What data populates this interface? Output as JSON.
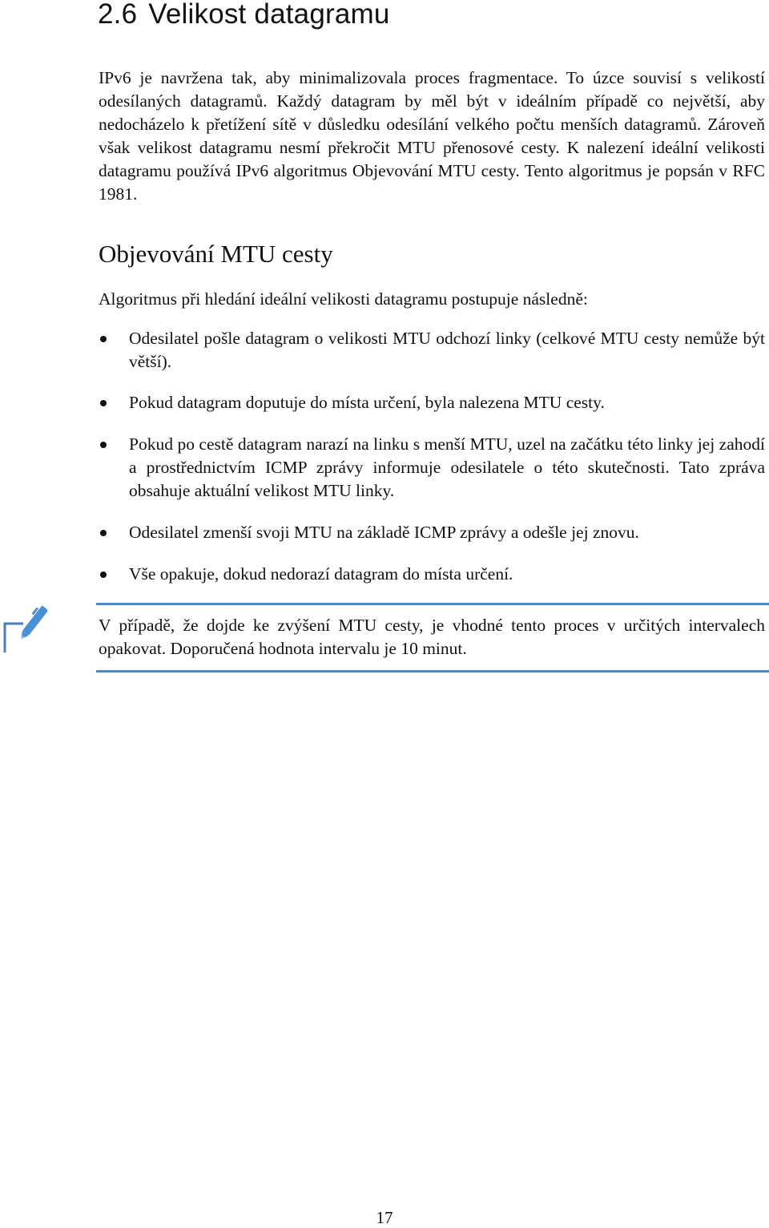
{
  "section": {
    "number": "2.6",
    "title": "Velikost datagramu"
  },
  "intro_paragraph": "IPv6 je navržena tak, aby minimalizovala proces fragmentace. To úzce souvisí s velikostí odesílaných datagramů. Každý datagram by měl být v ideálním případě co největší, aby nedocházelo k přetížení sítě v důsledku odesílání velkého počtu menších datagramů. Zároveň však velikost datagramu nesmí překročit MTU přenosové cesty. K nalezení ideální velikosti datagramu používá IPv6 algoritmus Objevování MTU cesty. Tento algoritmus je popsán v RFC 1981.",
  "subsection": {
    "title": "Objevování MTU cesty",
    "lead": "Algoritmus při hledání ideální velikosti datagramu postupuje následně:",
    "steps": [
      "Odesilatel pošle datagram o velikosti MTU odchozí linky (celkové MTU cesty nemůže být větší).",
      "Pokud datagram doputuje do místa určení, byla nalezena MTU cesty.",
      "Pokud po cestě datagram narazí na linku s menší MTU, uzel na začátku této linky jej zahodí a prostřednictvím ICMP zprávy informuje odesilatele o této skutečnosti. Tato zpráva obsahuje aktuální velikost MTU linky.",
      "Odesilatel zmenší svoji MTU na základě ICMP zprávy a odešle jej znovu.",
      "Vše opakuje, dokud nedorazí datagram do místa určení."
    ]
  },
  "note": {
    "icon": "pen-note-icon",
    "text": "V případě, že dojde ke zvýšení MTU cesty, je vhodné tento proces v určitých intervalech opakovat. Doporučená hodnota intervalu je 10 minut.",
    "accent_color": "#4a8bc8"
  },
  "footer": {
    "page_number": "17"
  }
}
